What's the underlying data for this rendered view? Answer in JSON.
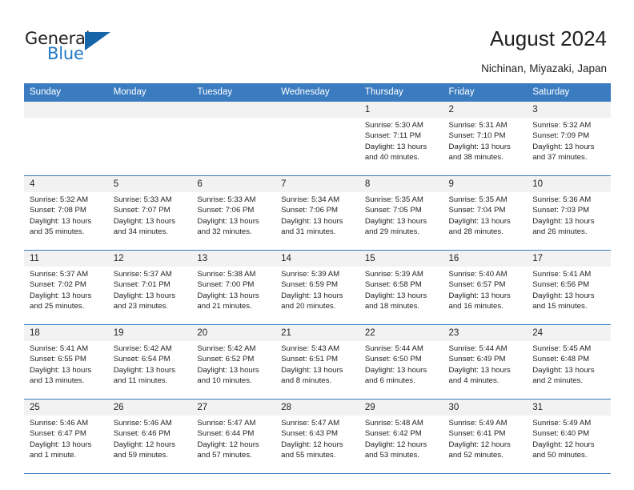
{
  "brand": {
    "name_part1": "General",
    "name_part2": "Blue",
    "triangle_color": "#1565a8",
    "blue_color": "#2079c7"
  },
  "header": {
    "title": "August 2024",
    "subtitle": "Nichinan, Miyazaki, Japan"
  },
  "theme": {
    "header_row_bg": "#3b7cc0",
    "daynum_bg": "#f2f2f2",
    "grid_line": "#3b7cc0",
    "text": "#231f20"
  },
  "weekdays": [
    "Sunday",
    "Monday",
    "Tuesday",
    "Wednesday",
    "Thursday",
    "Friday",
    "Saturday"
  ],
  "weeks": [
    [
      {
        "day": "",
        "sunrise": "",
        "sunset": "",
        "daylight": "",
        "empty": true
      },
      {
        "day": "",
        "sunrise": "",
        "sunset": "",
        "daylight": "",
        "empty": true
      },
      {
        "day": "",
        "sunrise": "",
        "sunset": "",
        "daylight": "",
        "empty": true
      },
      {
        "day": "",
        "sunrise": "",
        "sunset": "",
        "daylight": "",
        "empty": true
      },
      {
        "day": "1",
        "sunrise": "Sunrise: 5:30 AM",
        "sunset": "Sunset: 7:11 PM",
        "daylight": "Daylight: 13 hours and 40 minutes."
      },
      {
        "day": "2",
        "sunrise": "Sunrise: 5:31 AM",
        "sunset": "Sunset: 7:10 PM",
        "daylight": "Daylight: 13 hours and 38 minutes."
      },
      {
        "day": "3",
        "sunrise": "Sunrise: 5:32 AM",
        "sunset": "Sunset: 7:09 PM",
        "daylight": "Daylight: 13 hours and 37 minutes."
      }
    ],
    [
      {
        "day": "4",
        "sunrise": "Sunrise: 5:32 AM",
        "sunset": "Sunset: 7:08 PM",
        "daylight": "Daylight: 13 hours and 35 minutes."
      },
      {
        "day": "5",
        "sunrise": "Sunrise: 5:33 AM",
        "sunset": "Sunset: 7:07 PM",
        "daylight": "Daylight: 13 hours and 34 minutes."
      },
      {
        "day": "6",
        "sunrise": "Sunrise: 5:33 AM",
        "sunset": "Sunset: 7:06 PM",
        "daylight": "Daylight: 13 hours and 32 minutes."
      },
      {
        "day": "7",
        "sunrise": "Sunrise: 5:34 AM",
        "sunset": "Sunset: 7:06 PM",
        "daylight": "Daylight: 13 hours and 31 minutes."
      },
      {
        "day": "8",
        "sunrise": "Sunrise: 5:35 AM",
        "sunset": "Sunset: 7:05 PM",
        "daylight": "Daylight: 13 hours and 29 minutes."
      },
      {
        "day": "9",
        "sunrise": "Sunrise: 5:35 AM",
        "sunset": "Sunset: 7:04 PM",
        "daylight": "Daylight: 13 hours and 28 minutes."
      },
      {
        "day": "10",
        "sunrise": "Sunrise: 5:36 AM",
        "sunset": "Sunset: 7:03 PM",
        "daylight": "Daylight: 13 hours and 26 minutes."
      }
    ],
    [
      {
        "day": "11",
        "sunrise": "Sunrise: 5:37 AM",
        "sunset": "Sunset: 7:02 PM",
        "daylight": "Daylight: 13 hours and 25 minutes."
      },
      {
        "day": "12",
        "sunrise": "Sunrise: 5:37 AM",
        "sunset": "Sunset: 7:01 PM",
        "daylight": "Daylight: 13 hours and 23 minutes."
      },
      {
        "day": "13",
        "sunrise": "Sunrise: 5:38 AM",
        "sunset": "Sunset: 7:00 PM",
        "daylight": "Daylight: 13 hours and 21 minutes."
      },
      {
        "day": "14",
        "sunrise": "Sunrise: 5:39 AM",
        "sunset": "Sunset: 6:59 PM",
        "daylight": "Daylight: 13 hours and 20 minutes."
      },
      {
        "day": "15",
        "sunrise": "Sunrise: 5:39 AM",
        "sunset": "Sunset: 6:58 PM",
        "daylight": "Daylight: 13 hours and 18 minutes."
      },
      {
        "day": "16",
        "sunrise": "Sunrise: 5:40 AM",
        "sunset": "Sunset: 6:57 PM",
        "daylight": "Daylight: 13 hours and 16 minutes."
      },
      {
        "day": "17",
        "sunrise": "Sunrise: 5:41 AM",
        "sunset": "Sunset: 6:56 PM",
        "daylight": "Daylight: 13 hours and 15 minutes."
      }
    ],
    [
      {
        "day": "18",
        "sunrise": "Sunrise: 5:41 AM",
        "sunset": "Sunset: 6:55 PM",
        "daylight": "Daylight: 13 hours and 13 minutes."
      },
      {
        "day": "19",
        "sunrise": "Sunrise: 5:42 AM",
        "sunset": "Sunset: 6:54 PM",
        "daylight": "Daylight: 13 hours and 11 minutes."
      },
      {
        "day": "20",
        "sunrise": "Sunrise: 5:42 AM",
        "sunset": "Sunset: 6:52 PM",
        "daylight": "Daylight: 13 hours and 10 minutes."
      },
      {
        "day": "21",
        "sunrise": "Sunrise: 5:43 AM",
        "sunset": "Sunset: 6:51 PM",
        "daylight": "Daylight: 13 hours and 8 minutes."
      },
      {
        "day": "22",
        "sunrise": "Sunrise: 5:44 AM",
        "sunset": "Sunset: 6:50 PM",
        "daylight": "Daylight: 13 hours and 6 minutes."
      },
      {
        "day": "23",
        "sunrise": "Sunrise: 5:44 AM",
        "sunset": "Sunset: 6:49 PM",
        "daylight": "Daylight: 13 hours and 4 minutes."
      },
      {
        "day": "24",
        "sunrise": "Sunrise: 5:45 AM",
        "sunset": "Sunset: 6:48 PM",
        "daylight": "Daylight: 13 hours and 2 minutes."
      }
    ],
    [
      {
        "day": "25",
        "sunrise": "Sunrise: 5:46 AM",
        "sunset": "Sunset: 6:47 PM",
        "daylight": "Daylight: 13 hours and 1 minute."
      },
      {
        "day": "26",
        "sunrise": "Sunrise: 5:46 AM",
        "sunset": "Sunset: 6:46 PM",
        "daylight": "Daylight: 12 hours and 59 minutes."
      },
      {
        "day": "27",
        "sunrise": "Sunrise: 5:47 AM",
        "sunset": "Sunset: 6:44 PM",
        "daylight": "Daylight: 12 hours and 57 minutes."
      },
      {
        "day": "28",
        "sunrise": "Sunrise: 5:47 AM",
        "sunset": "Sunset: 6:43 PM",
        "daylight": "Daylight: 12 hours and 55 minutes."
      },
      {
        "day": "29",
        "sunrise": "Sunrise: 5:48 AM",
        "sunset": "Sunset: 6:42 PM",
        "daylight": "Daylight: 12 hours and 53 minutes."
      },
      {
        "day": "30",
        "sunrise": "Sunrise: 5:49 AM",
        "sunset": "Sunset: 6:41 PM",
        "daylight": "Daylight: 12 hours and 52 minutes."
      },
      {
        "day": "31",
        "sunrise": "Sunrise: 5:49 AM",
        "sunset": "Sunset: 6:40 PM",
        "daylight": "Daylight: 12 hours and 50 minutes."
      }
    ]
  ]
}
